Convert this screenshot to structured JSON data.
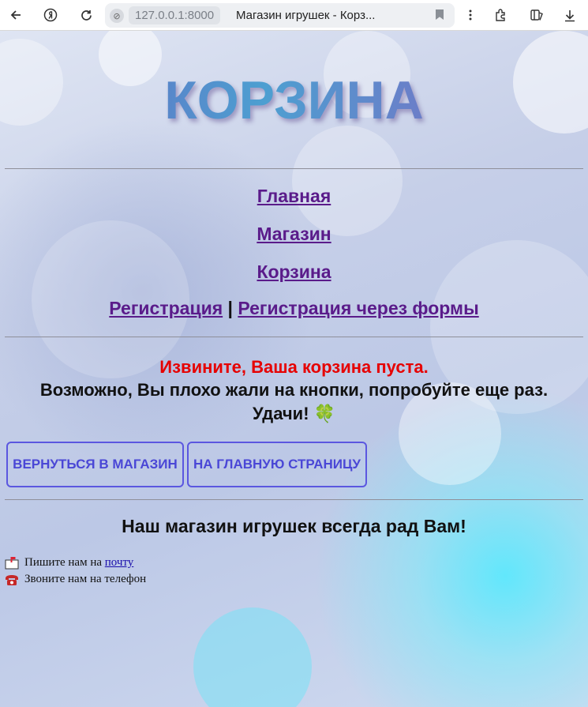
{
  "browser": {
    "url": "127.0.0.1:8000",
    "tab_title": "Магазин игрушек - Корз..."
  },
  "header": {
    "title": "КОРЗИНА"
  },
  "nav": {
    "home": "Главная",
    "shop": "Магазин",
    "cart": "Корзина",
    "register": "Регистрация",
    "separator": "|",
    "register_forms": "Регистрация через формы"
  },
  "cart": {
    "empty_message": "Извините, Ваша корзина пуста.",
    "hint_line1": "Возможно, Вы плохо жали на кнопки, попробуйте еще раз.",
    "hint_line2": "Удачи! 🍀"
  },
  "buttons": {
    "back_to_shop": "Вернуться в магазин",
    "to_home": "На главную страницу"
  },
  "footer": {
    "title": "Наш магазин игрушек всегда рад Вам!",
    "mail_text": "Пишите нам на ",
    "mail_link": "почту",
    "phone_text": "Звоните нам на телефон"
  },
  "colors": {
    "error": "#e60000",
    "link": "#5a1b8a",
    "button_border": "#5b57e0"
  },
  "icons": [
    "back-icon",
    "yandex-icon",
    "reload-icon",
    "site-info-icon",
    "bookmark-icon",
    "menu-icon",
    "extensions-icon",
    "collections-icon",
    "download-icon",
    "mail-icon",
    "phone-icon"
  ]
}
